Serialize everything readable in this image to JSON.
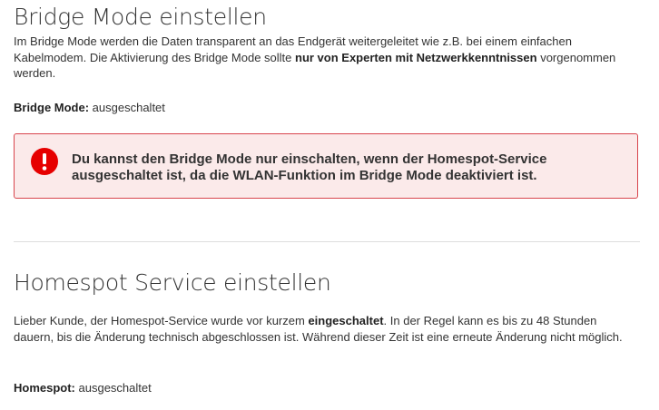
{
  "bridge": {
    "title": "Bridge Mode einstellen",
    "desc_part1": "Im Bridge Mode werden die Daten transparent an das Endgerät weitergeleitet wie z.B. bei einem einfachen Kabelmodem. Die Aktivierung des Bridge Mode sollte ",
    "desc_bold": "nur von Experten mit Netzwerkkenntnissen",
    "desc_part2": " vorgenommen werden.",
    "status_label": "Bridge Mode:",
    "status_value": " ausgeschaltet",
    "alert_icon": "exclamation-circle-icon",
    "alert_text": "Du kannst den Bridge Mode nur einschalten, wenn der Homespot-Service ausgeschaltet ist, da die WLAN-Funktion im Bridge Mode deaktiviert ist.",
    "alert_color": "#e60000"
  },
  "homespot": {
    "title": "Homespot Service einstellen",
    "desc_part1": "Lieber Kunde, der Homespot-Service wurde vor kurzem ",
    "desc_bold": "eingeschaltet",
    "desc_part2": ". In der Regel kann es bis zu 48 Stunden dauern, bis die Änderung technisch abgeschlossen ist. Während dieser Zeit ist eine erneute Änderung nicht möglich.",
    "status_label": "Homespot:",
    "status_value": " ausgeschaltet"
  }
}
